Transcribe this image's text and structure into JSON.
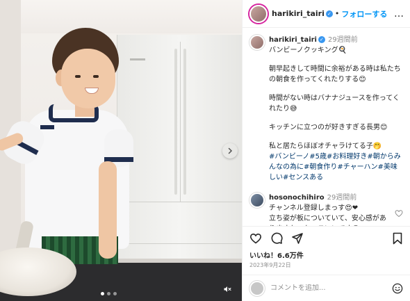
{
  "post": {
    "username": "harikiri_tairi",
    "follow_label": "フォローする",
    "separator": "•",
    "more_label": "…"
  },
  "caption": {
    "username": "harikiri_tairi",
    "time": "29週間前",
    "lines": [
      "バンビーノクッキング🍳",
      "",
      "朝早起きして時間に余裕がある時は私たちの朝食を作ってくれたりする😊",
      "",
      "時間がない時はバナナジュースを作ってくれたり😅",
      "",
      "キッチンに立つのが好きすぎる長男😊",
      "",
      "私と居たらほぼオチャラけてる子🤭"
    ],
    "hashtags": "#バンビーノ#5歳#お料理好き#朝からみんなの為に#朝食作り#チャーハン#美味しい#センスある"
  },
  "comment": {
    "username": "hosonochihiro",
    "time": "29週間前",
    "text": "チャンネル登録しまっす😍❤\n立ち姿が板についていて、安心感がありますね。かっこいいです😍"
  },
  "engagement": {
    "likes": "いいね！6.6万件",
    "date": "2023年9月22日"
  },
  "composer": {
    "placeholder": "コメントを追加..."
  },
  "carousel": {
    "slide_count": 3,
    "active_index": 0
  },
  "icons": {
    "verified": "verified-badge-icon",
    "more": "more-options-icon",
    "like": "heart-icon",
    "comment": "comment-icon",
    "share": "paper-plane-icon",
    "save": "bookmark-icon",
    "emoji": "smiley-icon",
    "mute": "muted-speaker-icon",
    "next": "chevron-right-icon"
  },
  "colors": {
    "accent": "#0095f6",
    "verified": "#3897f0",
    "text": "#262626",
    "muted": "#8e8e8e",
    "hashtag": "#00376b"
  }
}
